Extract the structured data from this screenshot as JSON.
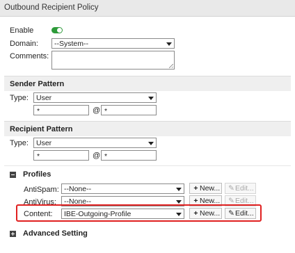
{
  "window": {
    "title": "Outbound Recipient Policy"
  },
  "policy": {
    "enable_label": "Enable",
    "enabled": true,
    "domain_label": "Domain:",
    "domain_value": "--System--",
    "comments_label": "Comments:",
    "comments_value": ""
  },
  "sender": {
    "header": "Sender Pattern",
    "type_label": "Type:",
    "type_value": "User",
    "user_value": "*",
    "at": "@",
    "domain_value": "*"
  },
  "recipient": {
    "header": "Recipient Pattern",
    "type_label": "Type:",
    "type_value": "User",
    "user_value": "*",
    "at": "@",
    "domain_value": "*"
  },
  "profiles": {
    "header": "Profiles",
    "rows": [
      {
        "label": "AntiSpam:",
        "value": "--None--",
        "new_label": "New...",
        "edit_label": "Edit..."
      },
      {
        "label": "AntiVirus:",
        "value": "--None--",
        "new_label": "New...",
        "edit_label": "Edit..."
      },
      {
        "label": "Content:",
        "value": "IBE-Outgoing-Profile",
        "new_label": "New...",
        "edit_label": "Edit..."
      }
    ]
  },
  "advanced": {
    "header": "Advanced Setting"
  },
  "colors": {
    "toggle_on": "#2e9b3a",
    "highlight": "#e02020",
    "section_bg": "#efefef"
  }
}
